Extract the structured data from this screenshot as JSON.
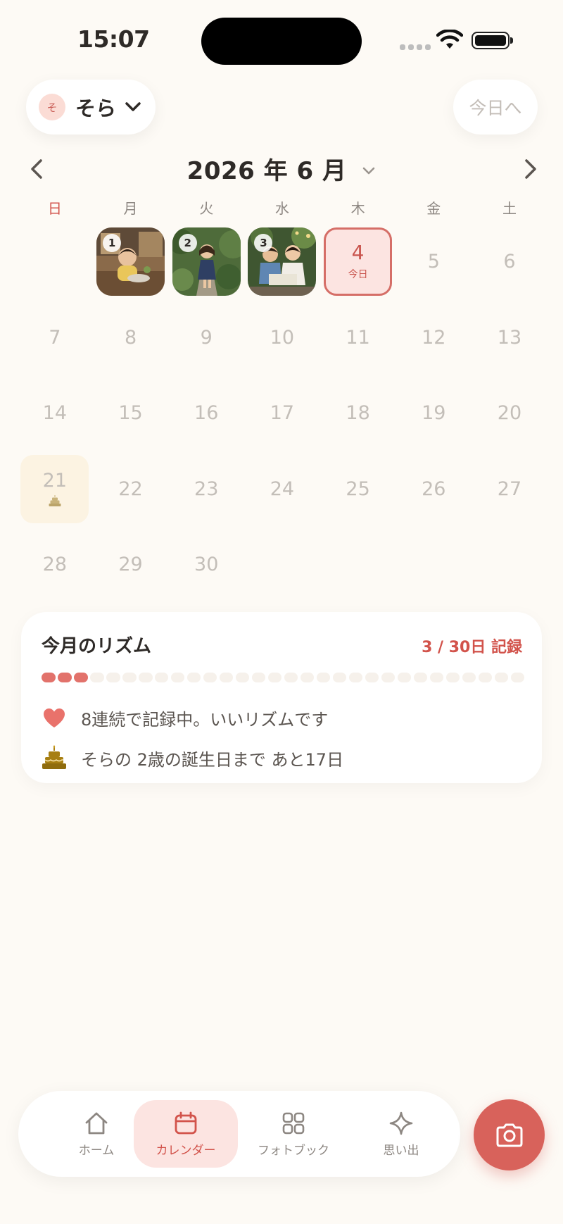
{
  "status": {
    "time": "15:07"
  },
  "header": {
    "child_initial": "そ",
    "child_name": "そら",
    "today_button": "今日へ"
  },
  "calendar": {
    "month_title": "2026 年 6 月",
    "weekdays": [
      "日",
      "月",
      "火",
      "水",
      "木",
      "金",
      "土"
    ],
    "days": [
      {
        "num": "1",
        "photo": 1,
        "badge": "1"
      },
      {
        "num": "2",
        "photo": 2,
        "badge": "2"
      },
      {
        "num": "3",
        "photo": 3,
        "badge": "3"
      },
      {
        "num": "4",
        "today": true,
        "label": "今日"
      },
      {
        "num": "5"
      },
      {
        "num": "6"
      },
      {
        "num": "7"
      },
      {
        "num": "8"
      },
      {
        "num": "9"
      },
      {
        "num": "10"
      },
      {
        "num": "11"
      },
      {
        "num": "12"
      },
      {
        "num": "13"
      },
      {
        "num": "14"
      },
      {
        "num": "15"
      },
      {
        "num": "16"
      },
      {
        "num": "17"
      },
      {
        "num": "18"
      },
      {
        "num": "19"
      },
      {
        "num": "20"
      },
      {
        "num": "21",
        "birthday": true
      },
      {
        "num": "22"
      },
      {
        "num": "23"
      },
      {
        "num": "24"
      },
      {
        "num": "25"
      },
      {
        "num": "26"
      },
      {
        "num": "27"
      },
      {
        "num": "28"
      },
      {
        "num": "29"
      },
      {
        "num": "30"
      }
    ],
    "first_weekday_offset": 1
  },
  "rhythm": {
    "title": "今月のリズム",
    "count": "3 / 30日 記録",
    "recorded_days": 3,
    "total_days": 30,
    "streak_text": "8連続で記録中。いいリズムです",
    "birthday_text": "そらの 2歳の誕生日まで あと17日"
  },
  "tabs": [
    {
      "label": "ホーム",
      "icon": "home-icon"
    },
    {
      "label": "カレンダー",
      "icon": "calendar-icon",
      "active": true
    },
    {
      "label": "フォトブック",
      "icon": "grid-icon"
    },
    {
      "label": "思い出",
      "icon": "sparkle-icon"
    }
  ],
  "colors": {
    "background": "#FDFAF5",
    "accent": "#D8625B",
    "accent_soft": "#FCE4E1",
    "muted_text": "#C3BEB8"
  }
}
